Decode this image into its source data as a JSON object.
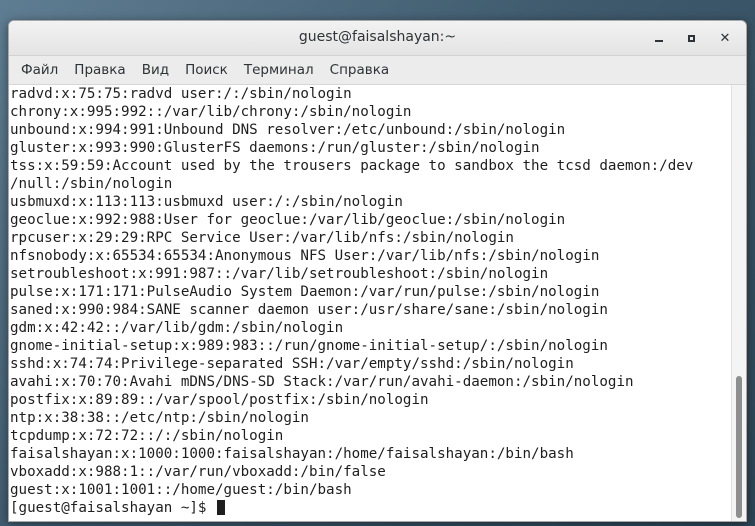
{
  "window": {
    "title": "guest@faisalshayan:~"
  },
  "menubar": {
    "items": [
      "Файл",
      "Правка",
      "Вид",
      "Поиск",
      "Терминал",
      "Справка"
    ]
  },
  "terminal": {
    "lines": [
      "radvd:x:75:75:radvd user:/:/sbin/nologin",
      "chrony:x:995:992::/var/lib/chrony:/sbin/nologin",
      "unbound:x:994:991:Unbound DNS resolver:/etc/unbound:/sbin/nologin",
      "gluster:x:993:990:GlusterFS daemons:/run/gluster:/sbin/nologin",
      "tss:x:59:59:Account used by the trousers package to sandbox the tcsd daemon:/dev",
      "/null:/sbin/nologin",
      "usbmuxd:x:113:113:usbmuxd user:/:/sbin/nologin",
      "geoclue:x:992:988:User for geoclue:/var/lib/geoclue:/sbin/nologin",
      "rpcuser:x:29:29:RPC Service User:/var/lib/nfs:/sbin/nologin",
      "nfsnobody:x:65534:65534:Anonymous NFS User:/var/lib/nfs:/sbin/nologin",
      "setroubleshoot:x:991:987::/var/lib/setroubleshoot:/sbin/nologin",
      "pulse:x:171:171:PulseAudio System Daemon:/var/run/pulse:/sbin/nologin",
      "saned:x:990:984:SANE scanner daemon user:/usr/share/sane:/sbin/nologin",
      "gdm:x:42:42::/var/lib/gdm:/sbin/nologin",
      "gnome-initial-setup:x:989:983::/run/gnome-initial-setup/:/sbin/nologin",
      "sshd:x:74:74:Privilege-separated SSH:/var/empty/sshd:/sbin/nologin",
      "avahi:x:70:70:Avahi mDNS/DNS-SD Stack:/var/run/avahi-daemon:/sbin/nologin",
      "postfix:x:89:89::/var/spool/postfix:/sbin/nologin",
      "ntp:x:38:38::/etc/ntp:/sbin/nologin",
      "tcpdump:x:72:72::/:/sbin/nologin",
      "faisalshayan:x:1000:1000:faisalshayan:/home/faisalshayan:/bin/bash",
      "vboxadd:x:988:1::/var/run/vboxadd:/bin/false",
      "guest:x:1001:1001::/home/guest:/bin/bash"
    ],
    "prompt": "[guest@faisalshayan ~]$ "
  }
}
